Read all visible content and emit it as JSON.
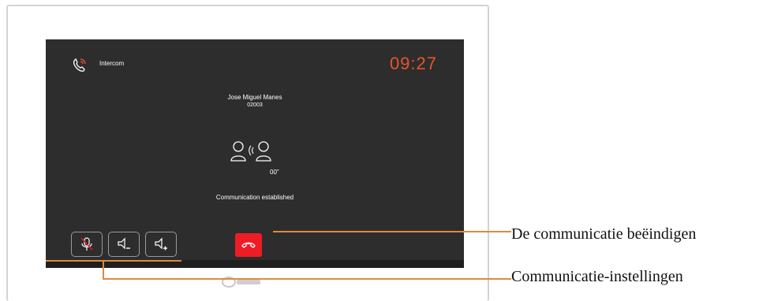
{
  "screen": {
    "mode_label": "Intercom",
    "clock": "09:27",
    "caller_name": "Jose Miguel Manes",
    "caller_id": "02003",
    "duration": "00”",
    "status": "Communication established"
  },
  "controls": {
    "mute_icon": "microphone-muted-icon",
    "volume_down_icon": "speaker-minus-icon",
    "volume_up_icon": "speaker-plus-icon",
    "hangup_icon": "hangup-icon"
  },
  "annotations": {
    "end_call": "De communicatie beëindigen",
    "settings": "Communicatie-instellingen"
  },
  "colors": {
    "screen_bg": "#2d2d2d",
    "clock": "#e8542c",
    "hangup": "#ee1c25",
    "callout": "#e08a3c"
  }
}
